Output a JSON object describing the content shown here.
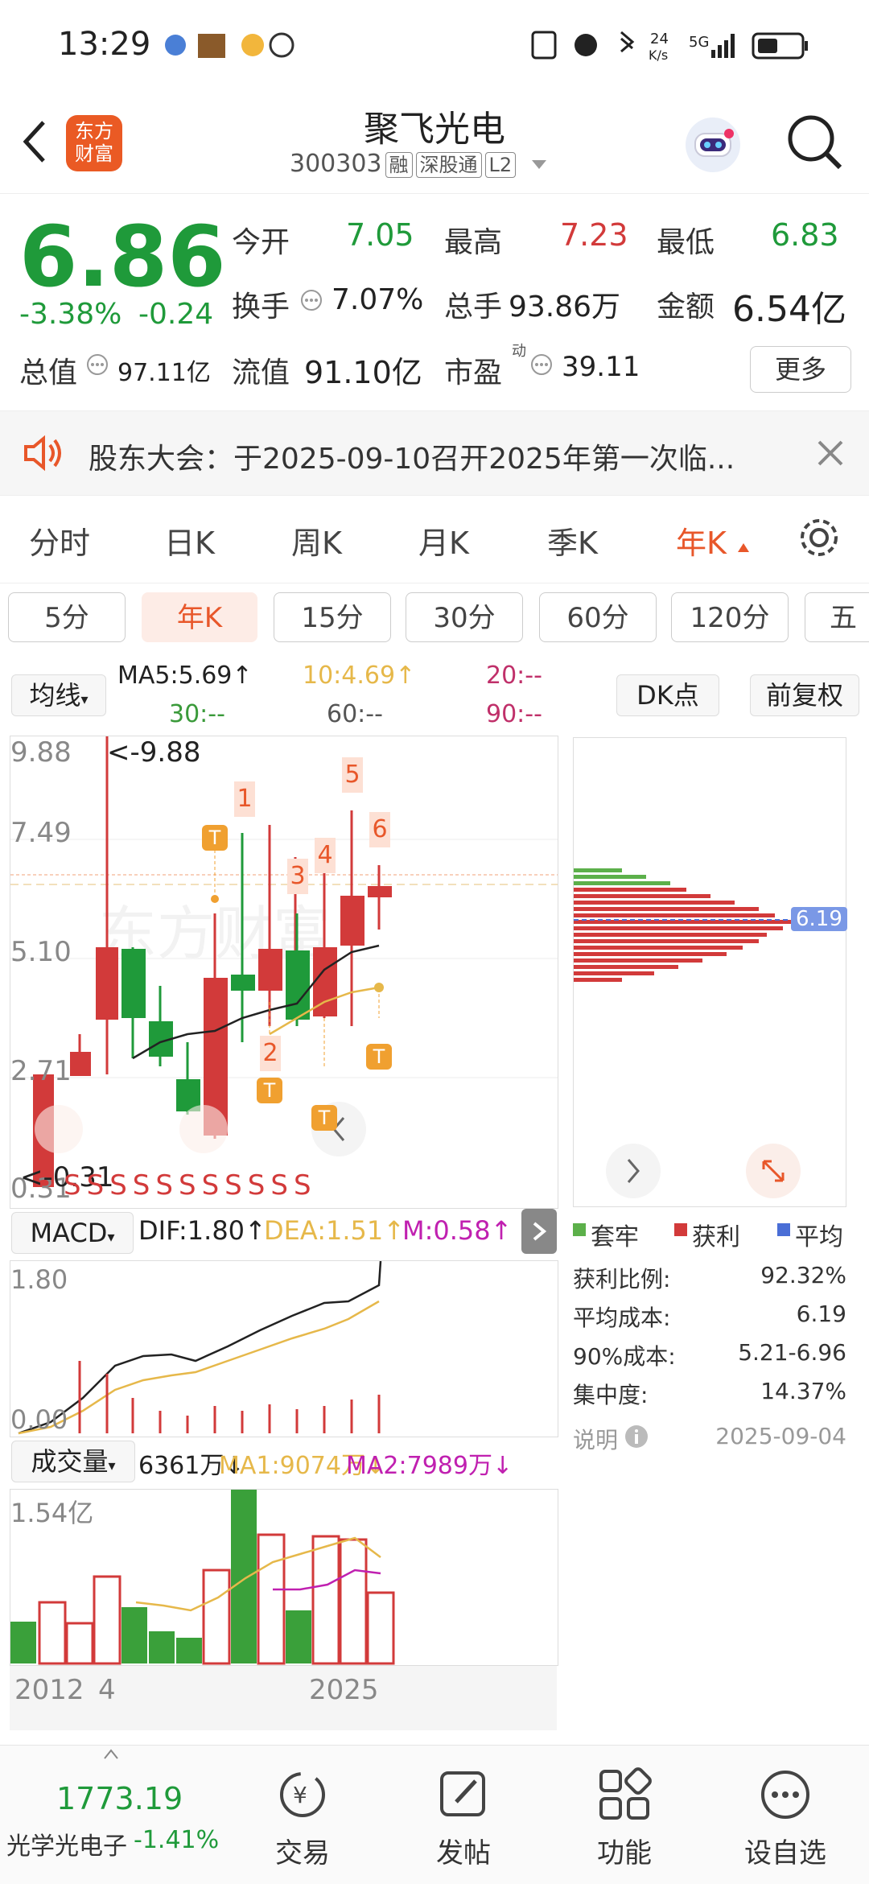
{
  "status_bar": {
    "time": "13:29",
    "net_speed": "24 K/s",
    "network": "5G"
  },
  "header": {
    "logo_line1": "东方",
    "logo_line2": "财富",
    "stock_name": "聚飞光电",
    "stock_code": "300303",
    "tags": [
      "融",
      "深股通",
      "L2"
    ]
  },
  "quote": {
    "price": "6.86",
    "change_pct": "-3.38%",
    "change_abs": "-0.24",
    "open_label": "今开",
    "open": "7.05",
    "high_label": "最高",
    "high": "7.23",
    "low_label": "最低",
    "low": "6.83",
    "turnover_label": "换手",
    "turnover": "7.07%",
    "volume_label": "总手",
    "volume": "93.86万",
    "amount_label": "金额",
    "amount": "6.54亿",
    "mktcap_label": "总值",
    "mktcap": "97.11亿",
    "float_label": "流值",
    "float_cap": "91.10亿",
    "pe_label": "市盈",
    "pe_sup": "动",
    "pe": "39.11",
    "more": "更多"
  },
  "notice": {
    "text": "股东大会：于2025-09-10召开2025年第一次临..."
  },
  "period_tabs": [
    "分时",
    "日K",
    "周K",
    "月K",
    "季K",
    "年K"
  ],
  "active_period": "年K",
  "interval_pills": [
    "5分",
    "年K",
    "15分",
    "30分",
    "60分",
    "120分",
    "五"
  ],
  "ma_row": {
    "select": "均线",
    "ma5": "MA5:5.69↑",
    "ma10": "10:4.69↑",
    "ma20": "20:--",
    "ma30": "30:--",
    "ma60": "60:--",
    "ma90": "90:--",
    "dk": "DK点",
    "adjust": "前复权"
  },
  "kchart": {
    "axis_labels": [
      "9.88",
      "7.49",
      "5.10",
      "2.71",
      "0.31"
    ],
    "max_label": "<-9.88",
    "min_label": "<-0.31",
    "markers": [
      "1",
      "2",
      "3",
      "4",
      "5",
      "6"
    ],
    "t_badge": "T",
    "s_badge": "S",
    "watermark": "东方财富"
  },
  "chip": {
    "avg_label": "6.19",
    "legend": [
      "套牢",
      "获利",
      "平均"
    ],
    "stats": [
      {
        "label": "获利比例:",
        "value": "92.32%"
      },
      {
        "label": "平均成本:",
        "value": "6.19"
      },
      {
        "label": "90%成本:",
        "value": "5.21-6.96"
      },
      {
        "label": "集中度:",
        "value": "14.37%"
      }
    ],
    "note_label": "说明",
    "date": "2025-09-04"
  },
  "macd": {
    "select": "MACD",
    "dif": "DIF:1.80↑",
    "dea": "DEA:1.51↑",
    "m": "M:0.58↑",
    "top": "1.80",
    "bottom": "0.00"
  },
  "volume": {
    "select": "成交量",
    "vol": "6361万↓",
    "ma1": "MA1:9074万↓",
    "ma2": "MA2:7989万↓",
    "top": "1.54亿",
    "x_start": "2012",
    "x_mid": "4",
    "x_end": "2025"
  },
  "bottom_nav": {
    "index_value": "1773.19",
    "index_name": "光学光电子",
    "index_change": "-1.41%",
    "items": [
      "交易",
      "发帖",
      "功能",
      "设自选"
    ]
  },
  "colors": {
    "up": "#d23a3a",
    "down": "#1f9a3a",
    "accent": "#e8572a"
  }
}
